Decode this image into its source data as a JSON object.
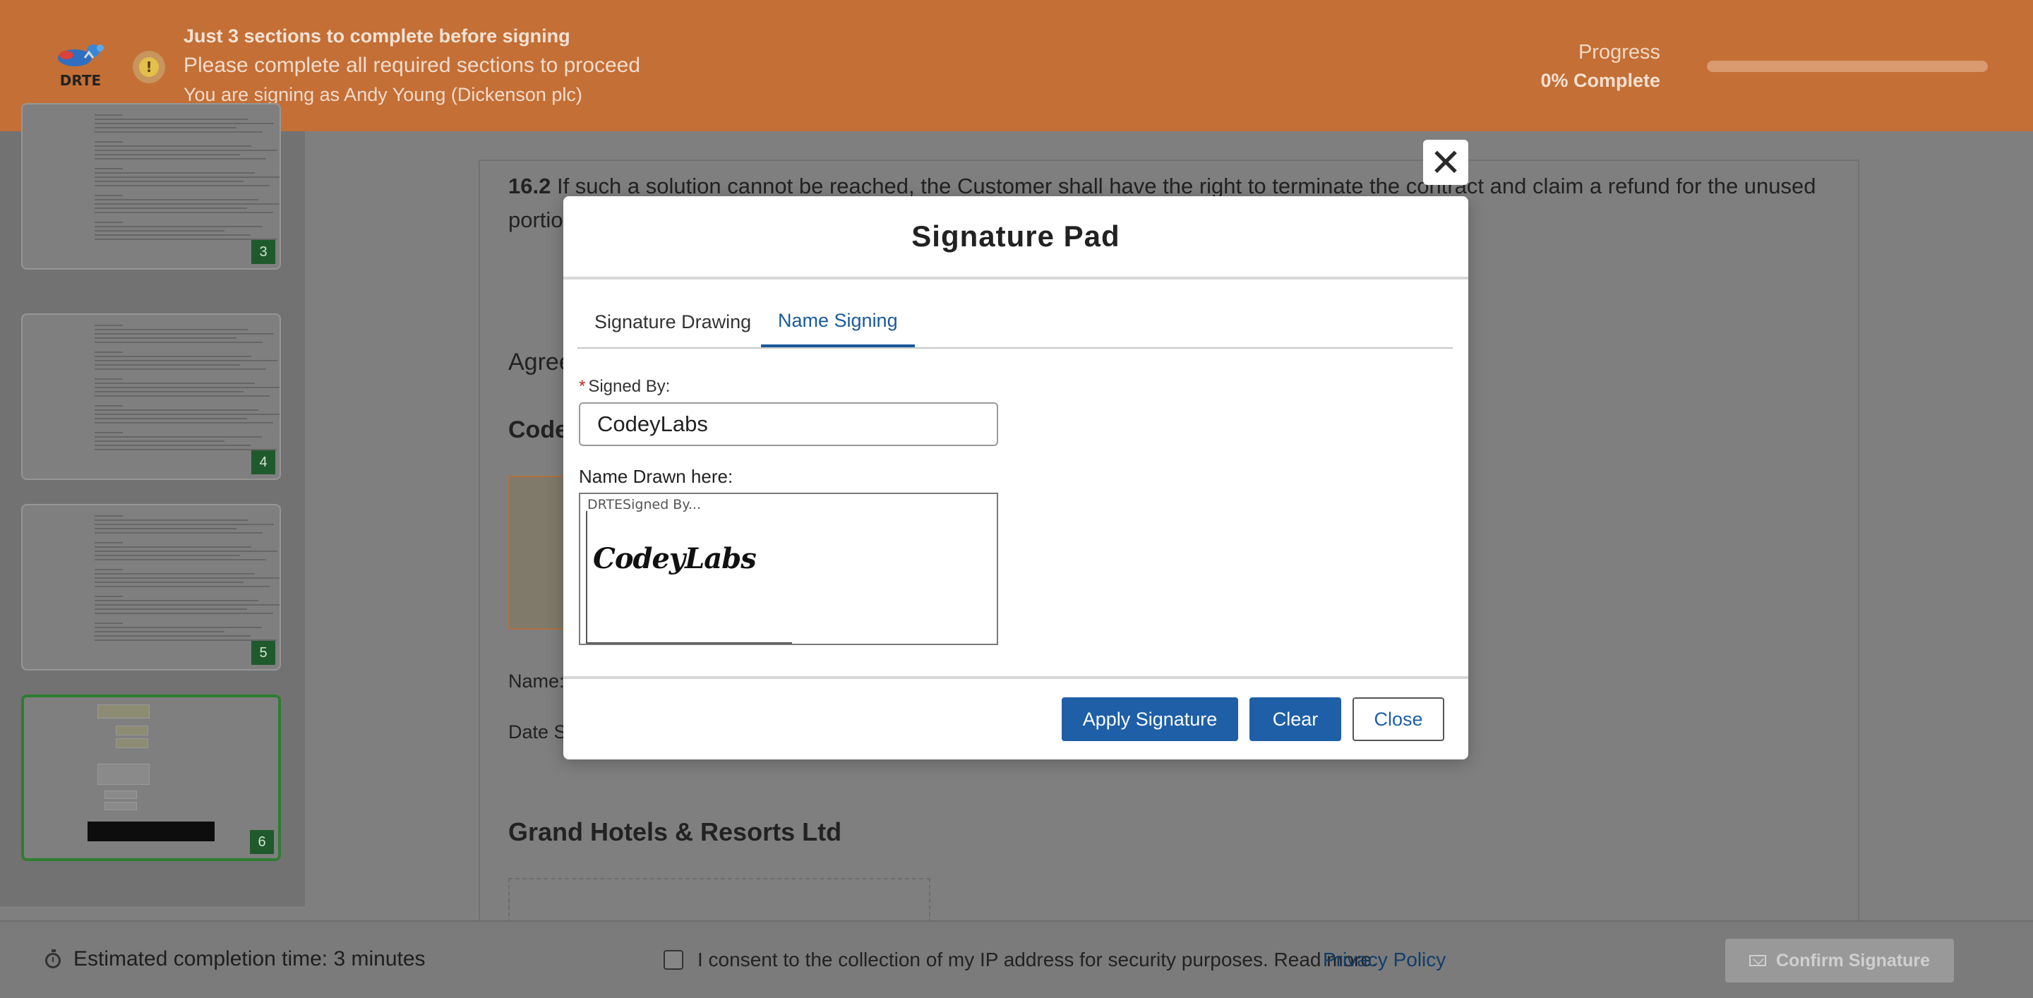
{
  "header": {
    "logo_text": "DRTE",
    "title": "Just 3 sections to complete before signing",
    "subtitle": "Please complete all required sections to proceed",
    "signing_as": "You are signing as Andy Young (Dickenson plc)",
    "progress_label": "Progress",
    "progress_value": "0% Complete",
    "progress_fraction": 0,
    "accent_color": "#c46f36"
  },
  "sidebar": {
    "pages": [
      {
        "number": "3",
        "active": false
      },
      {
        "number": "4",
        "active": false
      },
      {
        "number": "5",
        "active": false
      },
      {
        "number": "6",
        "active": true
      }
    ]
  },
  "document": {
    "clause_number": "16.2",
    "clause_text": " If such a solution cannot be reached, the Customer shall have the right to terminate the contract and claim a refund for the unused portion of the service.",
    "agreed_heading": "Agreed",
    "company_heading": "CodeyLabs",
    "name_label": "Name:",
    "date_label": "Date Signed:",
    "second_company": "Grand Hotels & Resorts Ltd"
  },
  "modal": {
    "title": "Signature Pad",
    "close_icon": "close-icon",
    "tabs": [
      {
        "label": "Signature Drawing",
        "active": false
      },
      {
        "label": "Name Signing",
        "active": true
      }
    ],
    "signed_by_label": "Signed By:",
    "signed_by_value": "CodeyLabs",
    "name_drawn_label": "Name Drawn here:",
    "drawn_watermark": "DRTESigned By...",
    "drawn_signature": "CodeyLabs",
    "apply_label": "Apply Signature",
    "clear_label": "Clear",
    "close_label": "Close",
    "primary_color": "#1e5fa8"
  },
  "footer": {
    "estimate": "Estimated completion time: 3 minutes",
    "consent_text": "I consent to the collection of my IP address for security purposes. Read more.",
    "privacy_link": "Privacy Policy",
    "confirm_label": "Confirm Signature"
  }
}
